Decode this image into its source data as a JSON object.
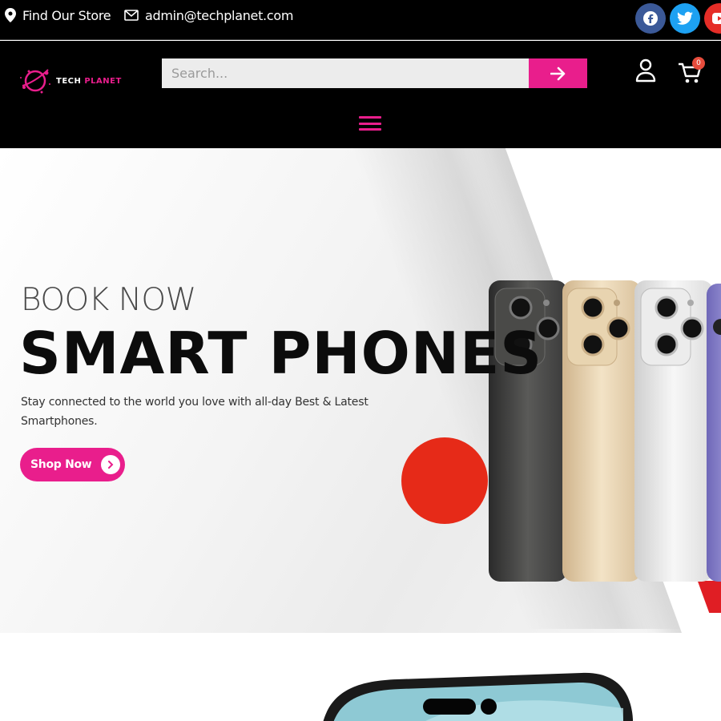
{
  "topbar": {
    "store_label": "Find Our Store",
    "email": "admin@techplanet.com",
    "social": [
      {
        "icon": "facebook-icon",
        "glyph": "f",
        "color": "#3b5998"
      },
      {
        "icon": "twitter-icon",
        "glyph": "t",
        "color": "#1da1f2"
      },
      {
        "icon": "youtube-icon",
        "glyph": "▶",
        "color": "#e52d27"
      }
    ]
  },
  "header": {
    "logo_text_white": "TECH ",
    "logo_text_pink": "PLANET",
    "search_placeholder": "Search...",
    "cart_count": "0"
  },
  "hero": {
    "kicker": "BOOK NOW",
    "title": "SMART PHONES",
    "description": "Stay connected to the world you love with all-day Best & Latest Smartphones.",
    "cta_label": "Shop Now"
  },
  "colors": {
    "accent": "#e91e8c",
    "topbar_bg": "#000000",
    "hero_circle": "#e62a18"
  }
}
